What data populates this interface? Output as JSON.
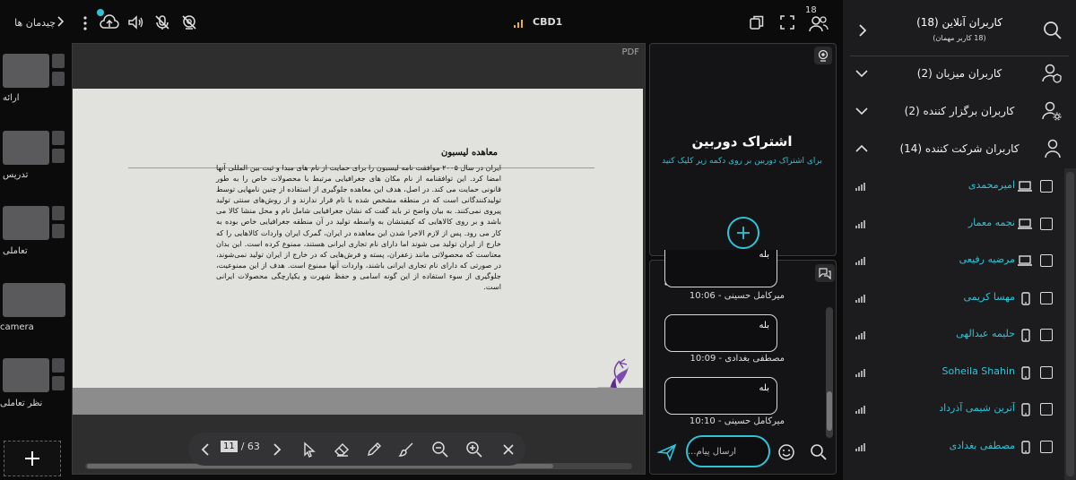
{
  "layouts_panel": {
    "header": "چیدمان ها",
    "items": [
      {
        "label": "ارائه"
      },
      {
        "label": "تدریس"
      },
      {
        "label": "تعاملی"
      },
      {
        "label": "camera"
      },
      {
        "label": "نظر تعاملی"
      }
    ]
  },
  "topbar": {
    "room_name": "CBD1",
    "participants_count": "18"
  },
  "viewer": {
    "file_type": "PDF",
    "slide": {
      "title": "معاهده لیسبون",
      "body": "ایران در سال ۲۰۰۵ موافقت نامه لیسبون را برای حمایت از نام های مبدا و ثبت بین المللی آنها امضا کرد. این توافقنامه از نام مکان های جغرافیایی مرتبط با محصولات خاص را به طور قانونی حمایت می کند. در اصل، هدف این معاهده جلوگیری از استفاده از چنین نامهایی توسط تولیدکنندگانی است که در منطقه مشخص شده با نام قرار ندارند و از روش‌های سنتی تولید پیروی نمی‌کنند. به بیان واضح تر باید گفت که نشان جغرافیایی شامل نام و محل منشا کالا می باشد و بر روی کالاهایی که کیفیتشان به واسطه تولید در آن منطقه جغرافیایی خاص بوده به کار می رود. پس از لازم الاجرا شدن این معاهده در ایران، گمرک ایران واردات کالاهایی را که خارج از ایران تولید می شوند اما دارای نام تجاری ایرانی هستند، ممنوع کرده است. این بدان معناست که محصولاتی مانند زعفران، پسته و فرش‌هایی که در خارج از ایران تولید نمی‌شوند، در صورتی که دارای نام تجاری ایرانی باشند، واردات آنها ممنوع است. هدف از این ممنوعیت، جلوگیری از سوء استفاده از این گونه اسامی و حفظ شهرت و یکپارچگی محصولات ایرانی است."
    }
  },
  "pager": {
    "current": "11",
    "total": "/ 63"
  },
  "camera_panel": {
    "title": "اشتراک دوربین",
    "subtitle": "برای اشتراک دوربین بر روی دکمه زیر کلیک کنید"
  },
  "chat": {
    "messages": [
      {
        "text": "بله",
        "meta": "میرکامل حسینی - 10:06"
      },
      {
        "text": "بله",
        "meta": "مصطفی بغدادی - 10:09"
      },
      {
        "text": "بله",
        "meta": "میرکامل حسینی - 10:10"
      }
    ],
    "input_placeholder": "ارسال پیام..."
  },
  "users_panel": {
    "title": "کاربران آنلاین (18)",
    "subtitle": "(18 کاربر مهمان)",
    "groups": [
      {
        "label": "کاربران میزبان (2)"
      },
      {
        "label": "کاربران برگزار کننده (2)"
      },
      {
        "label": "کاربران شرکت کننده (14)"
      }
    ],
    "participants": [
      {
        "name": "امیرمحمدی",
        "device": "laptop"
      },
      {
        "name": "نجمه معمار",
        "device": "laptop"
      },
      {
        "name": "مرضیه رفیعی",
        "device": "laptop"
      },
      {
        "name": "مهسا کریمی",
        "device": "phone"
      },
      {
        "name": "حلیمه عبدالهی",
        "device": "phone"
      },
      {
        "name": "Soheila Shahin",
        "device": "phone"
      },
      {
        "name": "آترین شیمی آذرداد",
        "device": "phone"
      },
      {
        "name": "مصطفی بغدادی",
        "device": "phone"
      }
    ]
  },
  "colors": {
    "accent": "#2fc3d6",
    "background": "#0b0b0c",
    "panel": "#1c1c1e"
  }
}
